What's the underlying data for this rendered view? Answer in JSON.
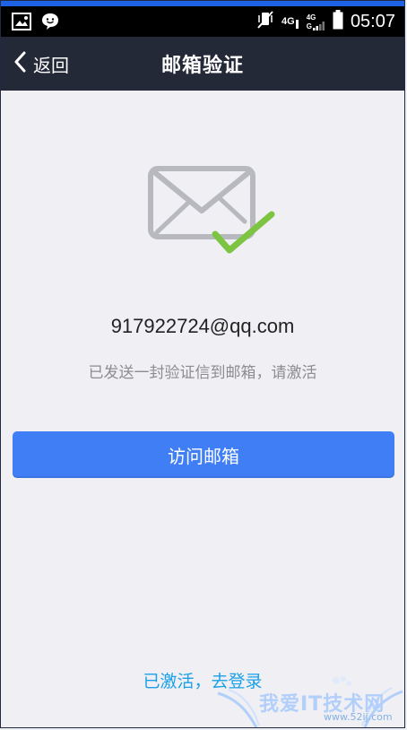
{
  "colors": {
    "top_accent": "#1e63e6",
    "statusbar_bg": "#000000",
    "navbar_bg": "#242938",
    "page_bg": "#efeff4",
    "button_bg": "#3f7ef5",
    "link": "#1aa0e6",
    "envelope": "#b7b9be",
    "check": "#7cc442"
  },
  "statusbar": {
    "left_icons": [
      "gallery-icon",
      "chat-bubble-icon"
    ],
    "right_icons": [
      "vibrate-muted-icon",
      "signal-4g-icon",
      "signal-4g-2-icon",
      "battery-icon"
    ],
    "network_label": "4G",
    "network_label_2": "4G",
    "network_label_3": "G",
    "time": "05:07"
  },
  "navbar": {
    "back_label": "返回",
    "title": "邮箱验证"
  },
  "content": {
    "email": "917922724@qq.com",
    "hint": "已发送一封验证信到邮箱，请激活",
    "visit_button_label": "访问邮箱",
    "login_link": "已激活，去登录"
  },
  "watermark": {
    "title": "我爱IT技术网",
    "url": "www.52ij.com"
  }
}
